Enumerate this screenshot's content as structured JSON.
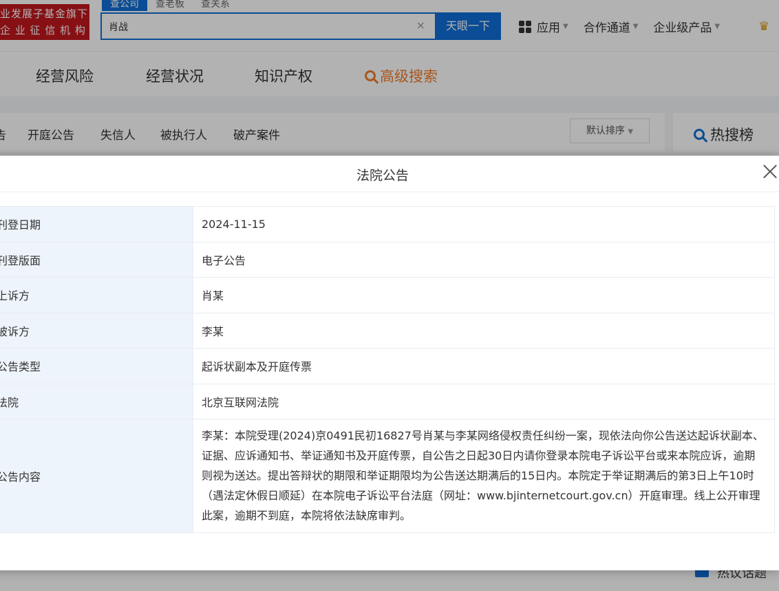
{
  "header": {
    "badge_line1": "业发展子基金旗下",
    "badge_line2": "企 业 征 信 机 构",
    "search_tabs": [
      "查公司",
      "查老板",
      "查关系"
    ],
    "search_value": "肖战",
    "search_button": "天眼一下",
    "menu_apps": "应用",
    "menu_partner": "合作通道",
    "menu_enterprise": "企业级产品"
  },
  "nav": {
    "items": [
      "经营风险",
      "经营状况",
      "知识产权"
    ],
    "advanced_search": "高级搜索"
  },
  "subnav": {
    "tabs": [
      "告",
      "开庭公告",
      "失信人",
      "被执行人",
      "破产案件"
    ],
    "sort_label": "默认排序",
    "hot_label": "热搜榜"
  },
  "footer_hint": "热议话题",
  "modal": {
    "title": "法院公告",
    "rows": [
      {
        "label": "刊登日期",
        "value": "2024-11-15"
      },
      {
        "label": "刊登版面",
        "value": "电子公告"
      },
      {
        "label": "上诉方",
        "value": "肖某"
      },
      {
        "label": "被诉方",
        "value": "李某"
      },
      {
        "label": "公告类型",
        "value": "起诉状副本及开庭传票"
      },
      {
        "label": "法院",
        "value": "北京互联网法院"
      },
      {
        "label": "公告内容",
        "value": "李某：本院受理(2024)京0491民初16827号肖某与李某网络侵权责任纠纷一案，现依法向你公告送达起诉状副本、证据、应诉通知书、举证通知书及开庭传票，自公告之日起30日内请你登录本院电子诉讼平台或来本院应诉，逾期则视为送达。提出答辩状的期限和举证期限均为公告送达期满后的15日内。本院定于举证期满后的第3日上午10时（遇法定休假日顺延）在本院电子诉讼平台法庭（网址：www.bjinternetcourt.gov.cn）开庭审理。线上公开审理此案，逾期不到庭，本院将依法缺席审判。"
      }
    ]
  }
}
